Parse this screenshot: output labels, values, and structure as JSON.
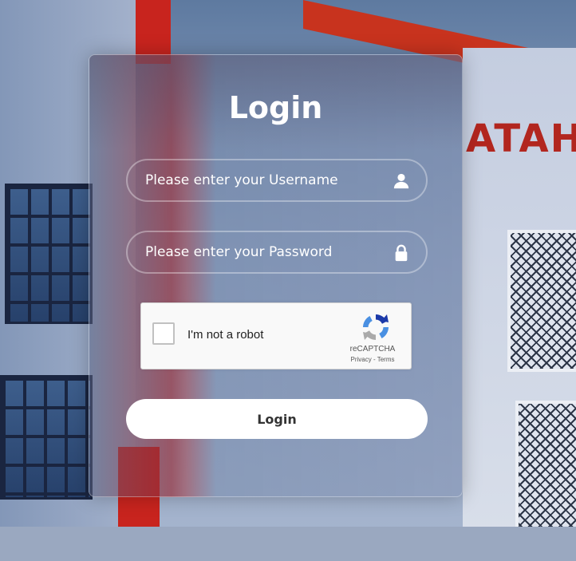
{
  "login": {
    "title": "Login",
    "username": {
      "placeholder": "Please enter your Username",
      "value": "",
      "icon": "user-icon"
    },
    "password": {
      "placeholder": "Please enter your Password",
      "value": "",
      "icon": "lock-icon"
    },
    "recaptcha": {
      "label": "I'm not a robot",
      "checked": false,
      "brand": "reCAPTCHA",
      "privacy": "Privacy",
      "separator": "-",
      "terms": "Terms"
    },
    "submit_label": "Login"
  },
  "colors": {
    "card_tint": "#7887aa",
    "accent_red": "#c8241e",
    "button_bg": "#ffffff",
    "button_text": "#333333"
  },
  "background": {
    "sign_text": "ATAH"
  }
}
